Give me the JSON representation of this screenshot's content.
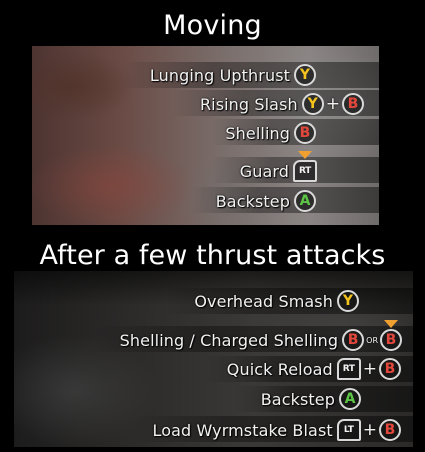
{
  "sections": [
    {
      "title": "Moving",
      "rows": [
        {
          "label": "Lunging Upthrust",
          "buttons": "Y"
        },
        {
          "label": "Rising Slash",
          "buttons": "Y + B"
        },
        {
          "label": "Shelling",
          "buttons": "B"
        },
        {
          "label": "Guard",
          "buttons": "hold RT"
        },
        {
          "label": "Backstep",
          "buttons": "A"
        }
      ]
    },
    {
      "title": "After a few thrust attacks",
      "rows": [
        {
          "label": "Overhead Smash",
          "buttons": "Y"
        },
        {
          "label": "Shelling / Charged Shelling",
          "buttons": "B OR hold B"
        },
        {
          "label": "Quick Reload",
          "buttons": "RT + B"
        },
        {
          "label": "Backstep",
          "buttons": "A"
        },
        {
          "label": "Load Wyrmstake Blast",
          "buttons": "LT + B"
        }
      ]
    }
  ],
  "glyphs": {
    "y": "Y",
    "b": "B",
    "a": "A",
    "rt": "RT",
    "lt": "LT",
    "plus": "+",
    "or": "OR"
  },
  "colors": {
    "button_y": "#f3c21c",
    "button_b": "#e2473b",
    "button_a": "#5cc545",
    "hold_arrow": "#f0a030",
    "text": "#f2f2f2",
    "background": "#000000"
  },
  "icons": {
    "hold": "orange-down-arrow-icon"
  }
}
